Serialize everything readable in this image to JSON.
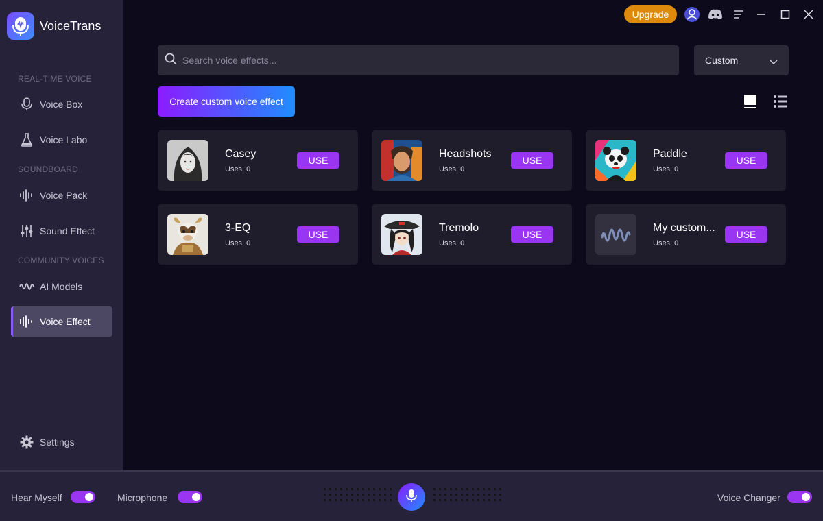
{
  "app": {
    "name": "VoiceTrans",
    "upgrade_label": "Upgrade"
  },
  "sidebar": {
    "sections": [
      {
        "label": "REAL-TIME VOICE"
      },
      {
        "label": "SOUNDBOARD"
      },
      {
        "label": "COMMUNITY VOICES"
      }
    ],
    "items": [
      {
        "label": "Voice Box",
        "icon": "mic-icon"
      },
      {
        "label": "Voice Labo",
        "icon": "flask-icon"
      },
      {
        "label": "Voice Pack",
        "icon": "waveform-icon"
      },
      {
        "label": "Sound Effect",
        "icon": "sliders-icon"
      },
      {
        "label": "AI Models",
        "icon": "waveform-icon"
      },
      {
        "label": "Voice Effect",
        "icon": "waveform-bars-icon",
        "active": true
      },
      {
        "label": "Settings",
        "icon": "gear-icon"
      }
    ]
  },
  "search": {
    "placeholder": "Search voice effects..."
  },
  "filter": {
    "selected": "Custom"
  },
  "create_button": {
    "label": "Create custom voice effect"
  },
  "cards": [
    {
      "name": "Casey",
      "uses": "Uses: 0",
      "button": "USE"
    },
    {
      "name": "Headshots",
      "uses": "Uses: 0",
      "button": "USE"
    },
    {
      "name": "Paddle",
      "uses": "Uses: 0",
      "button": "USE"
    },
    {
      "name": "3-EQ",
      "uses": "Uses: 0",
      "button": "USE"
    },
    {
      "name": "Tremolo",
      "uses": "Uses: 0",
      "button": "USE"
    },
    {
      "name": "My custom...",
      "uses": "Uses: 0",
      "button": "USE"
    }
  ],
  "bottom": {
    "hear_myself": {
      "label": "Hear Myself",
      "on": true
    },
    "microphone": {
      "label": "Microphone",
      "on": true
    },
    "voice_changer": {
      "label": "Voice Changer",
      "on": true
    }
  },
  "colors": {
    "accent": "#9a36f2",
    "upgrade": "#dd8a0c",
    "sidebar": "#25223a",
    "background": "#0c0a1b",
    "card": "#1f1c2c"
  }
}
